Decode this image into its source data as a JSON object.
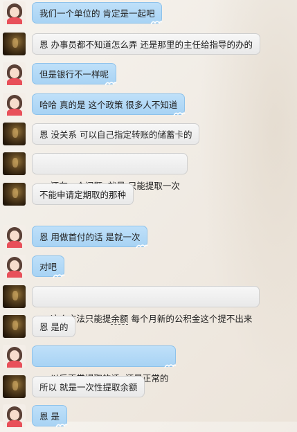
{
  "messages": [
    {
      "side": "girl",
      "text": "我们一个单位的 肯定是一起吧"
    },
    {
      "side": "man",
      "text": "恩 办事员都不知道怎么弄 还是那里的主任给指导的办的"
    },
    {
      "side": "girl",
      "text": "但是银行不一样呢"
    },
    {
      "side": "girl",
      "text": "哈哈 真的是 这个政策 很多人不知道"
    },
    {
      "side": "man",
      "text": "恩 没关系 可以自己指定转账的储蓄卡的"
    },
    {
      "side": "man",
      "text": "还有一个问题  就是 只能提取一次"
    },
    {
      "side": "man",
      "text": "不能申请定期取的那种"
    },
    {
      "side": "girl",
      "text": "恩 用做首付的话 是就一次"
    },
    {
      "side": "girl",
      "text": "对吧"
    },
    {
      "side": "man",
      "text_pre": "这个方法只能提",
      "text_u": "余额",
      "text_post": " 每个月新的公积金这个提不出来"
    },
    {
      "side": "man",
      "text": "恩 是的"
    },
    {
      "side": "girl",
      "text": "以后正常提取的话  还是正常的"
    },
    {
      "side": "man",
      "text": "所以 就是一次性提取余额"
    },
    {
      "side": "girl",
      "text": "恩 是"
    }
  ],
  "icons": {
    "girl_avatar": "girl-avatar-icon",
    "man_avatar": "man-avatar-icon",
    "bubble_tail": "wave-tail-icon"
  },
  "colors": {
    "blue_bubble": "#a8d3f4",
    "gray_bubble": "#eeeeee"
  }
}
